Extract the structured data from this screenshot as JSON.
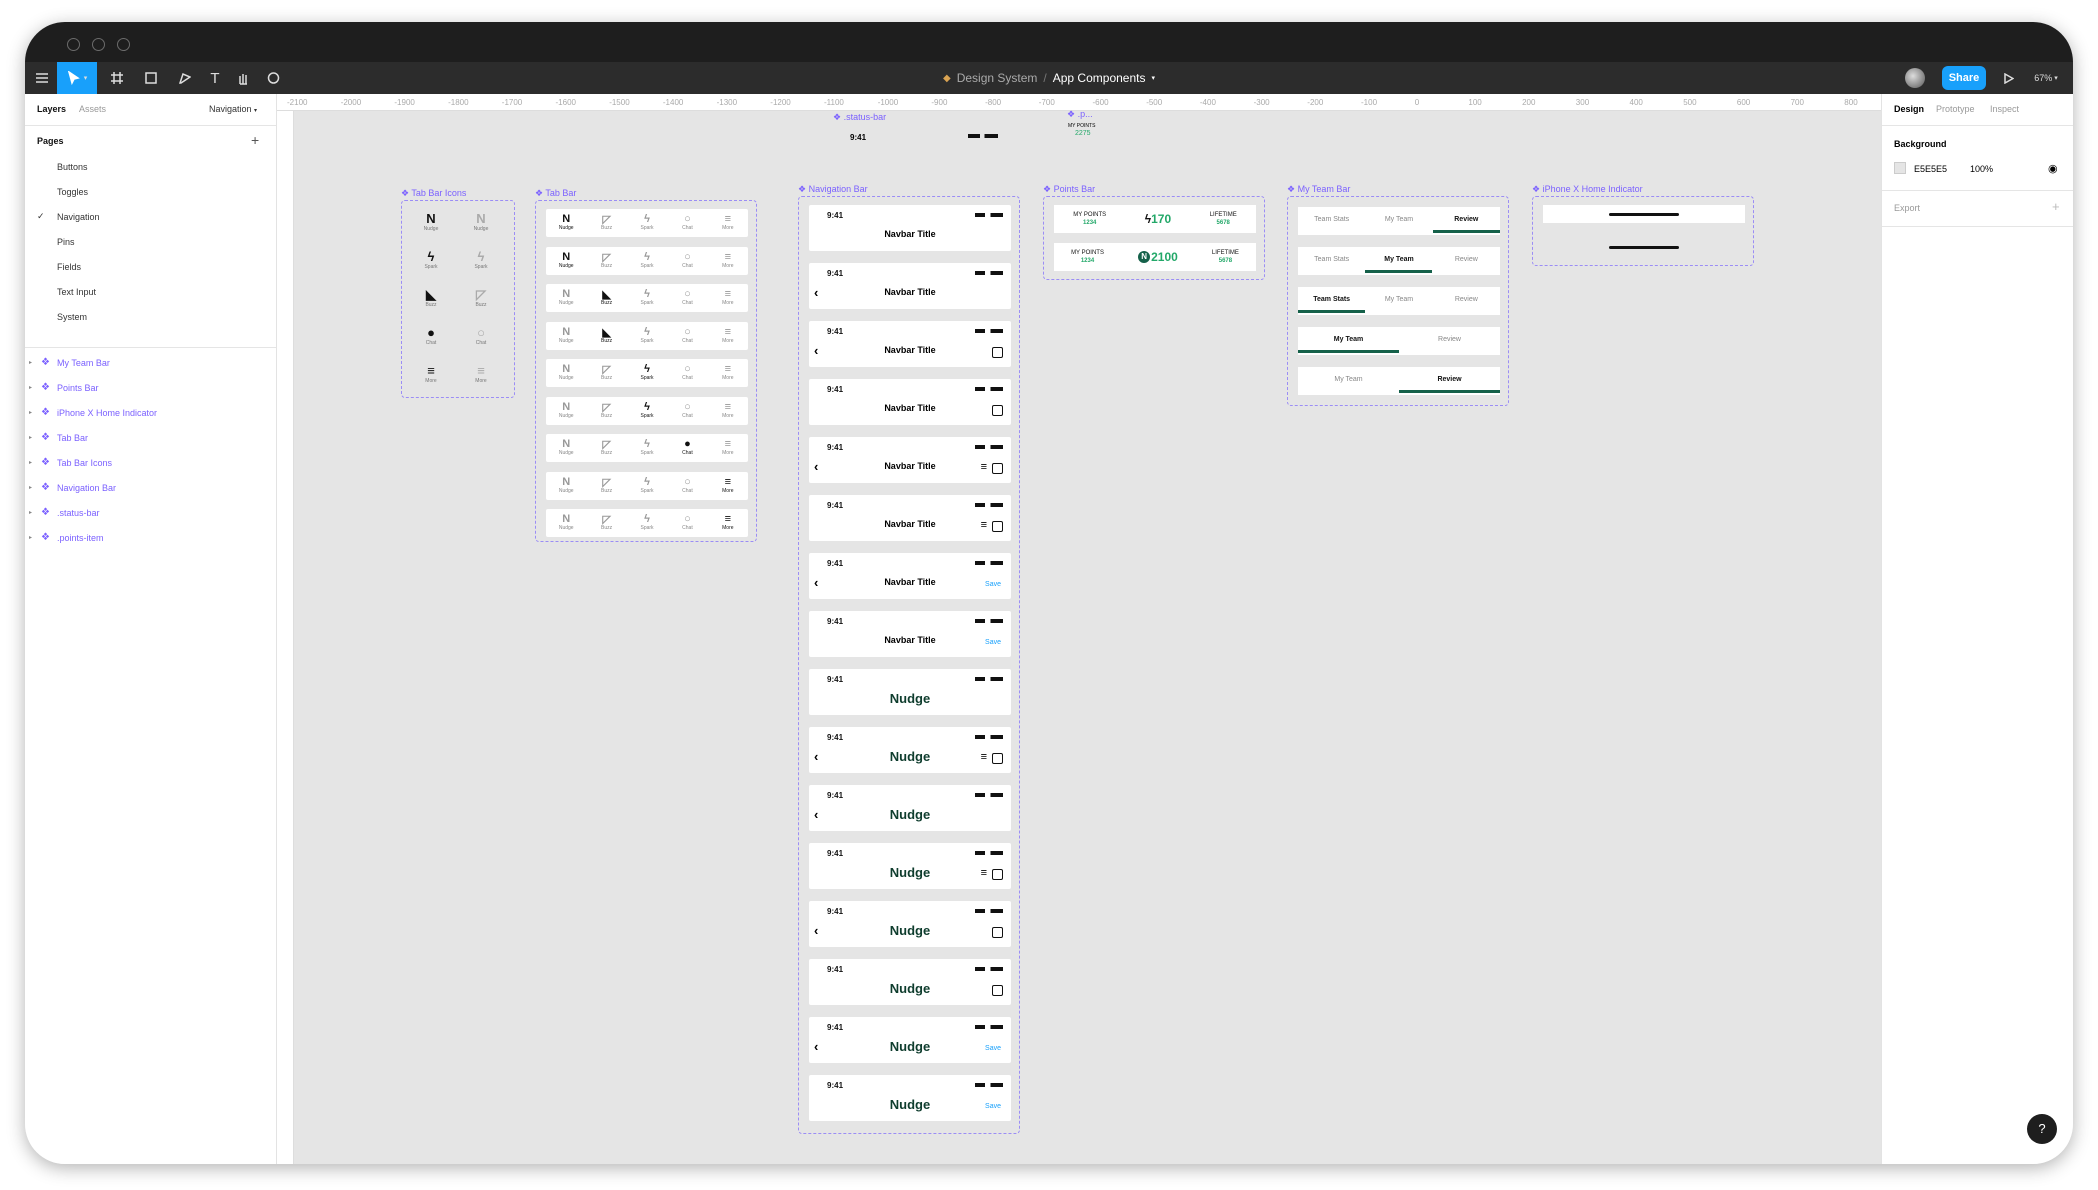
{
  "toolbar": {
    "file": "Design System",
    "separator": "/",
    "page": "App Components",
    "zoom": "67%",
    "share": "Share"
  },
  "left": {
    "tabs": [
      "Layers",
      "Assets"
    ],
    "page_dropdown": "Navigation",
    "pages_title": "Pages",
    "pages": [
      "Buttons",
      "Toggles",
      "Navigation",
      "Pins",
      "Fields",
      "Text Input",
      "System"
    ],
    "layers": [
      "My Team Bar",
      "Points Bar",
      "iPhone X Home Indicator",
      "Tab Bar",
      "Tab Bar Icons",
      "Navigation Bar",
      ".status-bar",
      ".points-item"
    ]
  },
  "right": {
    "tabs": [
      "Design",
      "Prototype",
      "Inspect"
    ],
    "background_label": "Background",
    "bg_hex": "E5E5E5",
    "bg_opacity": "100%",
    "export_label": "Export"
  },
  "ruler": [
    "-2100",
    "-2000",
    "-1900",
    "-1800",
    "-1700",
    "-1600",
    "-1500",
    "-1400",
    "-1300",
    "-1200",
    "-1100",
    "-1000",
    "-900",
    "-800",
    "-700",
    "-600",
    "-500",
    "-400",
    "-300",
    "-200",
    "-100",
    "0",
    "100",
    "200",
    "300",
    "400",
    "500",
    "600",
    "700",
    "800"
  ],
  "canvas": {
    "status_frame": {
      "label": ".status-bar",
      "time": "9:41"
    },
    "points_item": {
      "label": ".p...",
      "text": "MY POINTS",
      "value": "2275"
    },
    "tab_icons": {
      "label": "Tab Bar Icons",
      "items": [
        "Nudge",
        "Spark",
        "Buzz",
        "Chat",
        "More"
      ]
    },
    "tab_bar": {
      "label": "Tab Bar",
      "items": [
        "Nudge",
        "Buzz",
        "Spark",
        "Chat",
        "More"
      ]
    },
    "nav_bar": {
      "label": "Navigation Bar",
      "time": "9:41",
      "title": "Navbar Title",
      "big_title": "Nudge",
      "save": "Save"
    },
    "points_bar": {
      "label": "Points Bar",
      "my_points": "MY POINTS",
      "my_val": "1234",
      "lifetime": "LIFETIME",
      "life_val": "5678",
      "spark_val": "170",
      "nudge_val": "2100"
    },
    "team_bar": {
      "label": "My Team Bar",
      "tabs": [
        "Team Stats",
        "My Team",
        "Review"
      ],
      "two": [
        "My Team",
        "Review"
      ]
    },
    "home": {
      "label": "iPhone X Home Indicator"
    }
  },
  "colors": {
    "accent": "#18a0fb",
    "component": "#7b61ff",
    "brand": "#15614a",
    "points": "#23a869"
  }
}
